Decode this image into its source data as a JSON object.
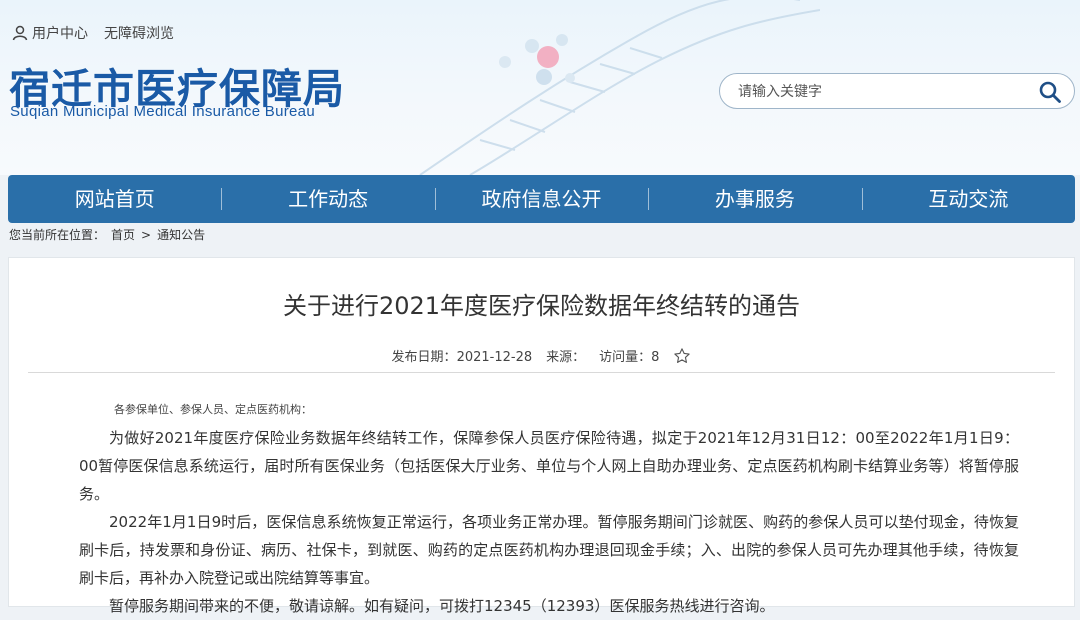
{
  "header": {
    "user_center": "用户中心",
    "accessibility": "无障碍浏览",
    "logo_cn": "宿迁市医疗保障局",
    "logo_en": "Suqian Municipal Medical Insurance Bureau",
    "search_placeholder": "请输入关键字"
  },
  "nav": {
    "items": [
      "网站首页",
      "工作动态",
      "政府信息公开",
      "办事服务",
      "互动交流"
    ]
  },
  "breadcrumb": {
    "prefix": "您当前所在位置：",
    "home": "首页",
    "separator": ">",
    "current": "通知公告"
  },
  "article": {
    "title": "关于进行2021年度医疗保险数据年终结转的通告",
    "date_label": "发布日期：",
    "date": "2021-12-28",
    "source_label": "来源：",
    "source": "",
    "views_label": "访问量：",
    "views": "8",
    "salutation": "各参保单位、参保人员、定点医药机构：",
    "paragraphs": [
      "为做好2021年度医疗保险业务数据年终结转工作，保障参保人员医疗保险待遇，拟定于2021年12月31日12：00至2022年1月1日9：00暂停医保信息系统运行，届时所有医保业务（包括医保大厅业务、单位与个人网上自助办理业务、定点医药机构刷卡结算业务等）将暂停服务。",
      "2022年1月1日9时后，医保信息系统恢复正常运行，各项业务正常办理。暂停服务期间门诊就医、购药的参保人员可以垫付现金，待恢复刷卡后，持发票和身份证、病历、社保卡，到就医、购药的定点医药机构办理退回现金手续；入、出院的参保人员可先办理其他手续，待恢复刷卡后，再补办入院登记或出院结算等事宜。",
      "暂停服务期间带来的不便，敬请谅解。如有疑问，可拨打12345（12393）医保服务热线进行咨询。"
    ]
  },
  "colors": {
    "brand_blue": "#1a5aa6",
    "nav_blue": "#2a6fa9"
  },
  "icons": [
    "user-icon",
    "search-icon",
    "star-icon"
  ]
}
